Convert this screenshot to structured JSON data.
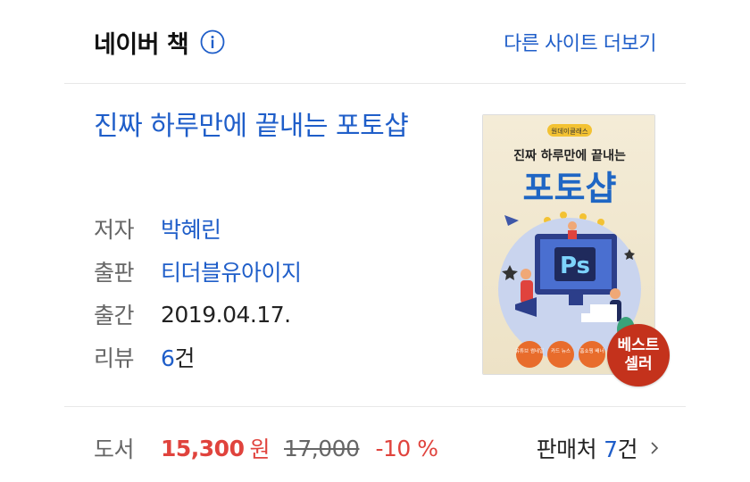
{
  "header": {
    "title": "네이버 책",
    "more_link": "다른 사이트 더보기",
    "info_icon": "info-icon"
  },
  "book": {
    "title": "진짜 하루만에 끝내는 포토샵",
    "meta": [
      {
        "key": "저자",
        "value": "박혜린"
      },
      {
        "key": "출판",
        "value": "티더블유아이지"
      },
      {
        "key": "출간",
        "value": "2019.04.17."
      }
    ],
    "review": {
      "key": "리뷰",
      "count": "6",
      "unit": "건"
    },
    "cover": {
      "series": "원데이클래스",
      "subtitle": "진짜 하루만에 끝내는",
      "title": "포토샵",
      "ps_text": "Ps",
      "tags": [
        "유튜브 썸네일",
        "카드 뉴스",
        "홈쇼핑 배너"
      ]
    },
    "badge": {
      "line1": "베스트",
      "line2": "셀러"
    }
  },
  "price": {
    "label": "도서",
    "sale": "15,300",
    "unit": "원",
    "original": "17,000",
    "discount": "-10 %",
    "seller_label": "판매처",
    "seller_count": "7건"
  },
  "colors": {
    "link": "#1f5ec9",
    "sale": "#e0433d",
    "badge": "#c4321c"
  }
}
